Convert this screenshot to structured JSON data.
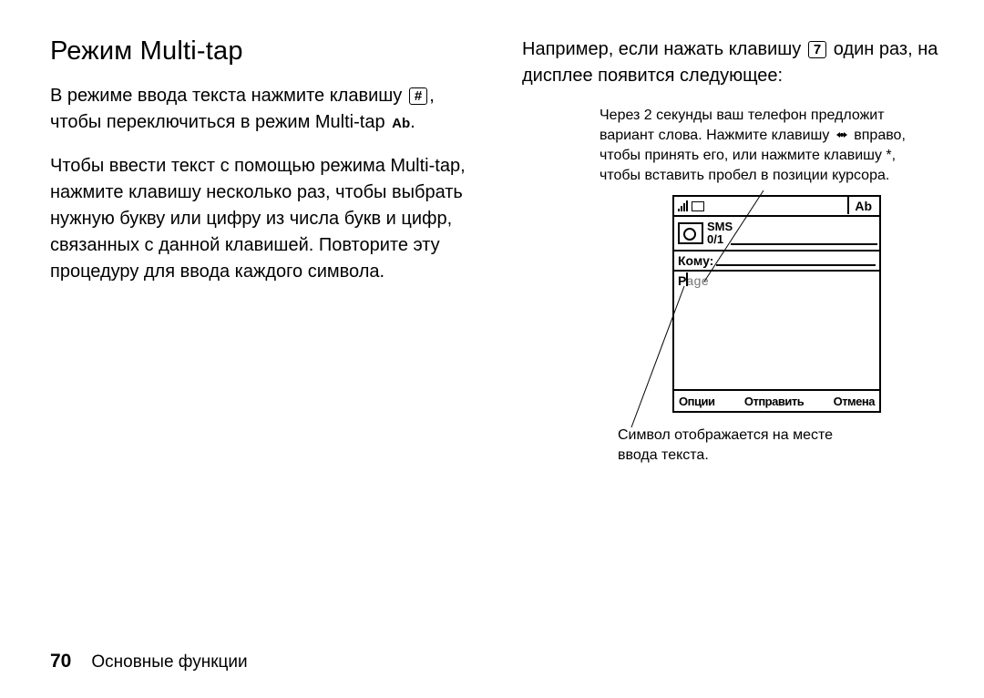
{
  "title": "Режим Multi-tap",
  "para1_a": "В режиме ввода текста нажмите клавишу ",
  "para1_key": "#",
  "para1_b": ", чтобы переключиться в режим Multi-tap ",
  "para1_mode": "Ab",
  "para1_c": ".",
  "para2": "Чтобы ввести текст с помощью режима Multi-tap, нажмите клавишу несколько раз, чтобы выбрать нужную букву или цифру из числа букв и цифр, связанных с данной клавишей. Повторите эту процедуру для ввода каждого символа.",
  "rpara_a": "Например, если нажать клавишу ",
  "rpara_key": "7",
  "rpara_b": " один раз, на дисплее появится следующее:",
  "callout_top_a": "Через 2 секунды ваш телефон предложит вариант слова. Нажмите клавишу ",
  "callout_top_b": " вправо, чтобы принять его, или нажмите клавишу *, чтобы вставить пробел в позиции курсора.",
  "screen": {
    "mode": "Ab",
    "sms_label": "SMS",
    "sms_count": "0/1",
    "to_label": "Кому:",
    "typed_char": "P",
    "ghost": "age",
    "softkey_left": "Опции",
    "softkey_center": "Отправить",
    "softkey_right": "Отмена"
  },
  "callout_bottom": "Символ отображается на месте ввода текста.",
  "footer": {
    "page": "70",
    "section": "Основные функции"
  }
}
